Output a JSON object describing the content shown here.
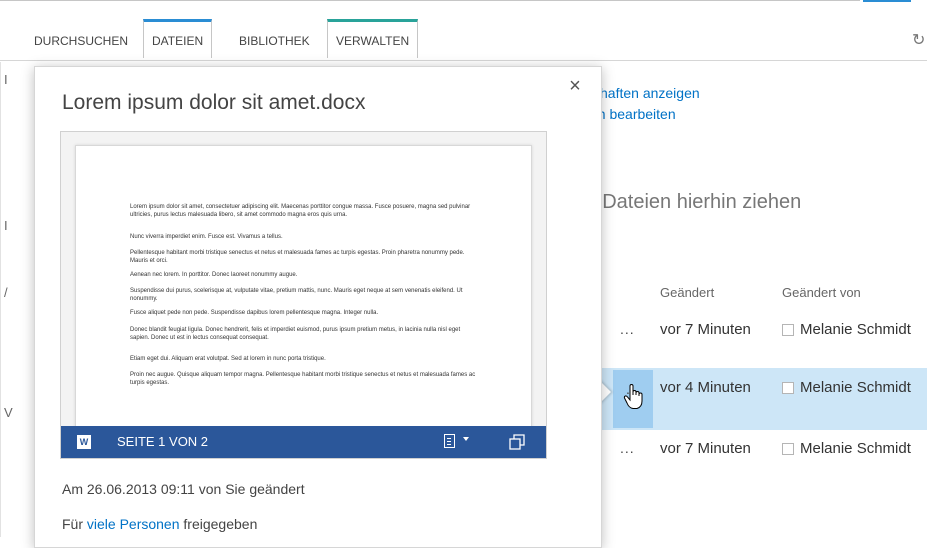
{
  "ribbon": {
    "tabs": [
      {
        "label": "DURCHSUCHEN"
      },
      {
        "label": "DATEIEN"
      },
      {
        "label": "BIBLIOTHEK"
      },
      {
        "label": "VERWALTEN"
      }
    ]
  },
  "background": {
    "link_properties": "haften anzeigen",
    "link_edit": "en bearbeiten",
    "drop_hint": "r Dateien hierhin ziehen",
    "columns": {
      "modified": "Geändert",
      "modified_by": "Geändert von"
    },
    "rows": [
      {
        "ellipsis": "...",
        "modified": "vor 7 Minuten",
        "modified_by": "Melanie Schmidt"
      },
      {
        "ellipsis": "...",
        "modified": "vor 4 Minuten",
        "modified_by": "Melanie Schmidt"
      },
      {
        "ellipsis": "...",
        "modified": "vor 7 Minuten",
        "modified_by": "Melanie Schmidt"
      }
    ]
  },
  "card": {
    "title": "Lorem ipsum dolor sit amet.docx",
    "close_label": "×",
    "preview": {
      "paragraphs": [
        "Lorem ipsum dolor sit amet, consectetuer adipiscing elit. Maecenas porttitor congue massa. Fusce posuere, magna sed pulvinar ultricies, purus lectus malesuada libero, sit amet commodo magna eros quis urna.",
        "Nunc viverra imperdiet enim. Fusce est. Vivamus a tellus.",
        "Pellentesque habitant morbi tristique senectus et netus et malesuada fames ac turpis egestas. Proin pharetra nonummy pede. Mauris et orci.",
        "Aenean nec lorem. In porttitor. Donec laoreet nonummy augue.",
        "Suspendisse dui purus, scelerisque at, vulputate vitae, pretium mattis, nunc. Mauris eget neque at sem venenatis eleifend. Ut nonummy.",
        "Fusce aliquet pede non pede. Suspendisse dapibus lorem pellentesque magna. Integer nulla.",
        "Donec blandit feugiat ligula. Donec hendrerit, felis et imperdiet euismod, purus ipsum pretium metus, in lacinia nulla nisl eget sapien. Donec ut est in lectus consequat consequat.",
        "Etiam eget dui. Aliquam erat volutpat. Sed at lorem in nunc porta tristique.",
        "Proin nec augue. Quisque aliquam tempor magna. Pellentesque habitant morbi tristique senectus et netus et malesuada fames ac turpis egestas."
      ],
      "word_badge": "W",
      "page_label": "SEITE 1 VON 2"
    },
    "modified_text": "Am 26.06.2013 09:11 von Sie geändert",
    "shared_prefix": "Für ",
    "shared_link": "viele Personen",
    "shared_suffix": " freigegeben"
  },
  "colors": {
    "accent_blue": "#2a8dd4",
    "accent_teal": "#29a39a",
    "word_blue": "#2b579a",
    "link": "#0072c6",
    "row_highlight": "#cde6f7"
  },
  "icons": [
    "sync-icon",
    "word-icon",
    "document-view-icon",
    "popout-icon",
    "close-icon",
    "hand-cursor-icon",
    "checkbox-icon"
  ]
}
